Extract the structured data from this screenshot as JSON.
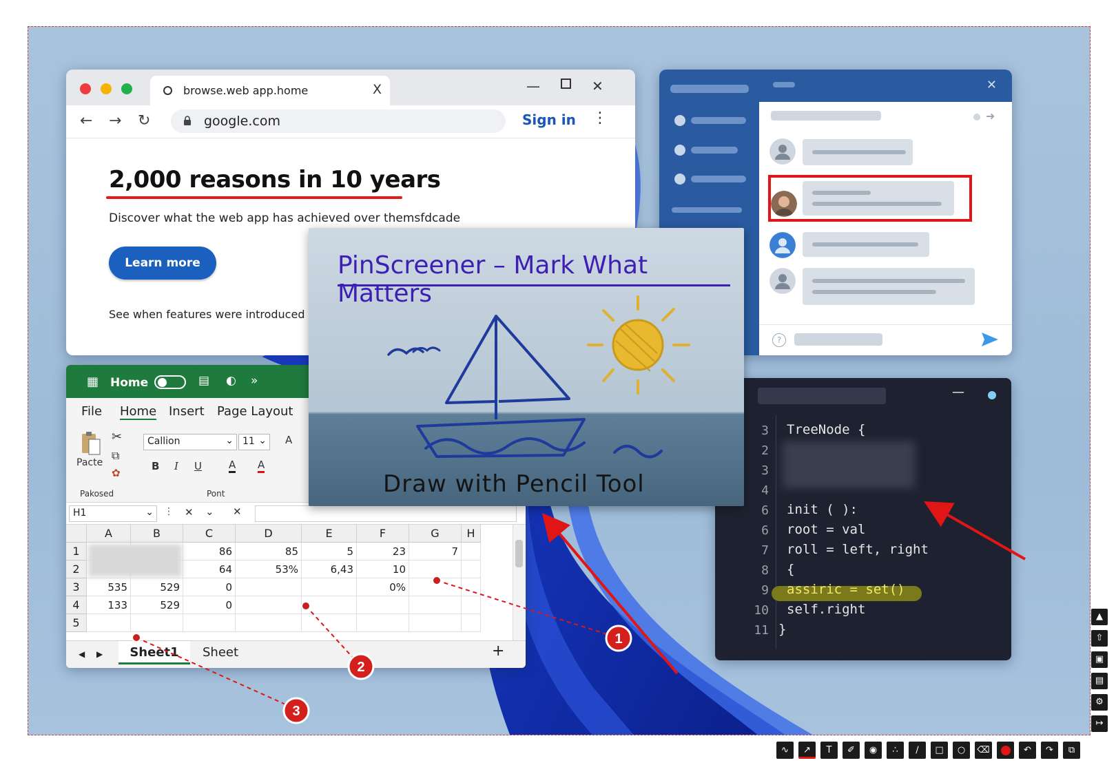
{
  "browser": {
    "tab_title": "browse.web app.home",
    "url": "google.com",
    "sign_in": "Sign in",
    "headline": "2,000 reasons in 10 years",
    "subtext": "Discover what the web app has achieved over themsfdcade",
    "learn_more": "Learn more",
    "features_link": "See when features were introduced",
    "close_glyph": "X"
  },
  "excel": {
    "title": "Home",
    "menu": [
      "File",
      "Home",
      "Insert",
      "Page Layout"
    ],
    "paste": "Pacte",
    "font_name": "Callion",
    "font_size": "11",
    "group_clipboard": "Pakosed",
    "group_font": "Pont",
    "name_box": "H1",
    "columns": [
      "A",
      "B",
      "C",
      "D",
      "E",
      "F",
      "G",
      "H"
    ],
    "rows": [
      {
        "num": "1",
        "cells": [
          "",
          "",
          "86",
          "85",
          "5",
          "23",
          "7",
          ""
        ]
      },
      {
        "num": "2",
        "cells": [
          "",
          "",
          "64",
          "53%",
          "6,43",
          "10",
          "",
          ""
        ]
      },
      {
        "num": "3",
        "cells": [
          "535",
          "529",
          "0",
          "",
          "",
          "0%",
          "",
          ""
        ]
      },
      {
        "num": "4",
        "cells": [
          "133",
          "529",
          "0",
          "",
          "",
          "",
          "",
          ""
        ]
      },
      {
        "num": "5",
        "cells": [
          "",
          "",
          "",
          "",
          "",
          "",
          "",
          ""
        ]
      }
    ],
    "sheets": [
      "Sheet1",
      "Sheet"
    ],
    "add_sheet": "+"
  },
  "code": {
    "lines": [
      {
        "num": "3",
        "text": "TreeNode {"
      },
      {
        "num": "2",
        "text": ""
      },
      {
        "num": "3",
        "text": ""
      },
      {
        "num": "4",
        "text": ""
      },
      {
        "num": "6",
        "text": "init ( ):"
      },
      {
        "num": "6",
        "text": "root = val"
      },
      {
        "num": "7",
        "text": "roll = left, right"
      },
      {
        "num": "8",
        "text": "{"
      },
      {
        "num": "9",
        "text": "assiric = set()"
      },
      {
        "num": "10",
        "text": "self.right"
      },
      {
        "num": "11",
        "text": "}"
      }
    ]
  },
  "pinscreener": {
    "title": "PinScreener – Mark What Matters",
    "caption": "Draw with Pencil Tool"
  },
  "badges": [
    "1",
    "2",
    "3"
  ],
  "colors": {
    "annotation_red": "#e01515",
    "excel_green": "#1f7a3e",
    "chat_blue": "#2a5aa0",
    "pin_title_purple": "#3c1fb3",
    "highlight_yellow": "#b7b42a"
  },
  "toolbars": {
    "side_icons": [
      "pin-icon",
      "share-icon",
      "save-icon",
      "folder-icon",
      "settings-icon",
      "exit-icon"
    ],
    "bottom_icons": [
      "pencil-icon",
      "arrow-icon",
      "text-icon",
      "marker-icon",
      "blur-icon",
      "steps-icon",
      "line-icon",
      "rectangle-icon",
      "ellipse-icon",
      "eraser-icon",
      "color-icon",
      "undo-icon",
      "redo-icon",
      "copy-icon"
    ]
  }
}
